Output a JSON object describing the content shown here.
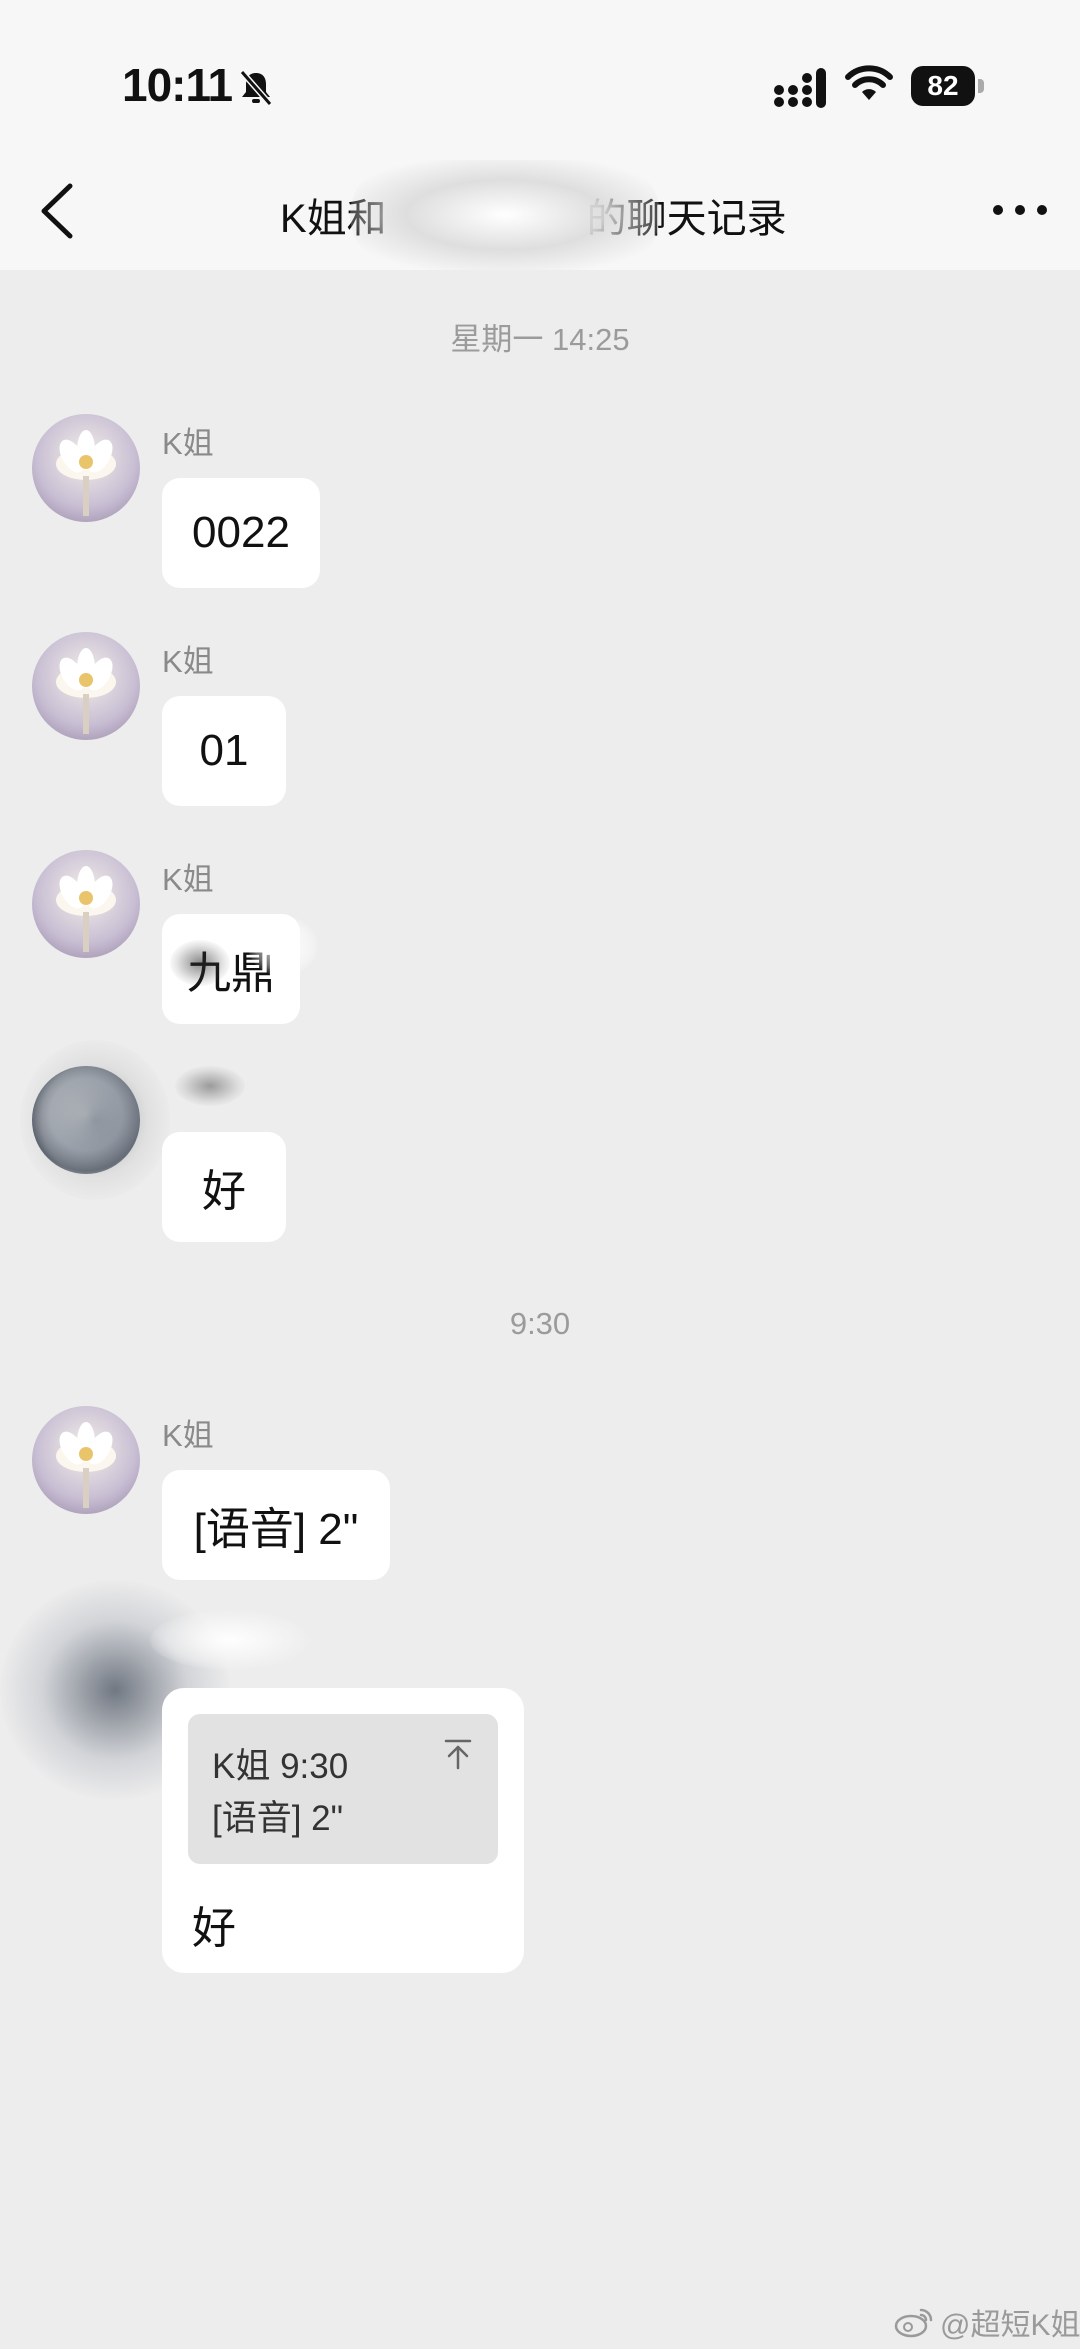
{
  "status_bar": {
    "time": "10:11",
    "battery": "82"
  },
  "header": {
    "title": "K姐和　　　　　的聊天记录"
  },
  "chat": {
    "timestamp_1": "星期一 14:25",
    "timestamp_2": "9:30",
    "messages": [
      {
        "sender": "K姐",
        "text": "0022"
      },
      {
        "sender": "K姐",
        "text": "01"
      },
      {
        "sender": "K姐",
        "text": "九鼎"
      },
      {
        "sender": "",
        "text": "好"
      },
      {
        "sender": "K姐",
        "text": "[语音] 2\""
      }
    ],
    "reply": {
      "quote_header": "K姐 9:30",
      "quote_content": "[语音] 2\"",
      "text": "好"
    }
  },
  "watermark": "@超短K姐",
  "colors": {
    "background": "#ededed",
    "header_bg": "#f7f7f7",
    "bubble": "#ffffff",
    "quote_box": "#e2e2e2",
    "muted_text": "#8a8a8a"
  },
  "icons": [
    "bell-slash-icon",
    "signal-icon",
    "wifi-icon",
    "battery-icon",
    "back-icon",
    "more-icon",
    "pin-top-icon",
    "weibo-icon"
  ]
}
